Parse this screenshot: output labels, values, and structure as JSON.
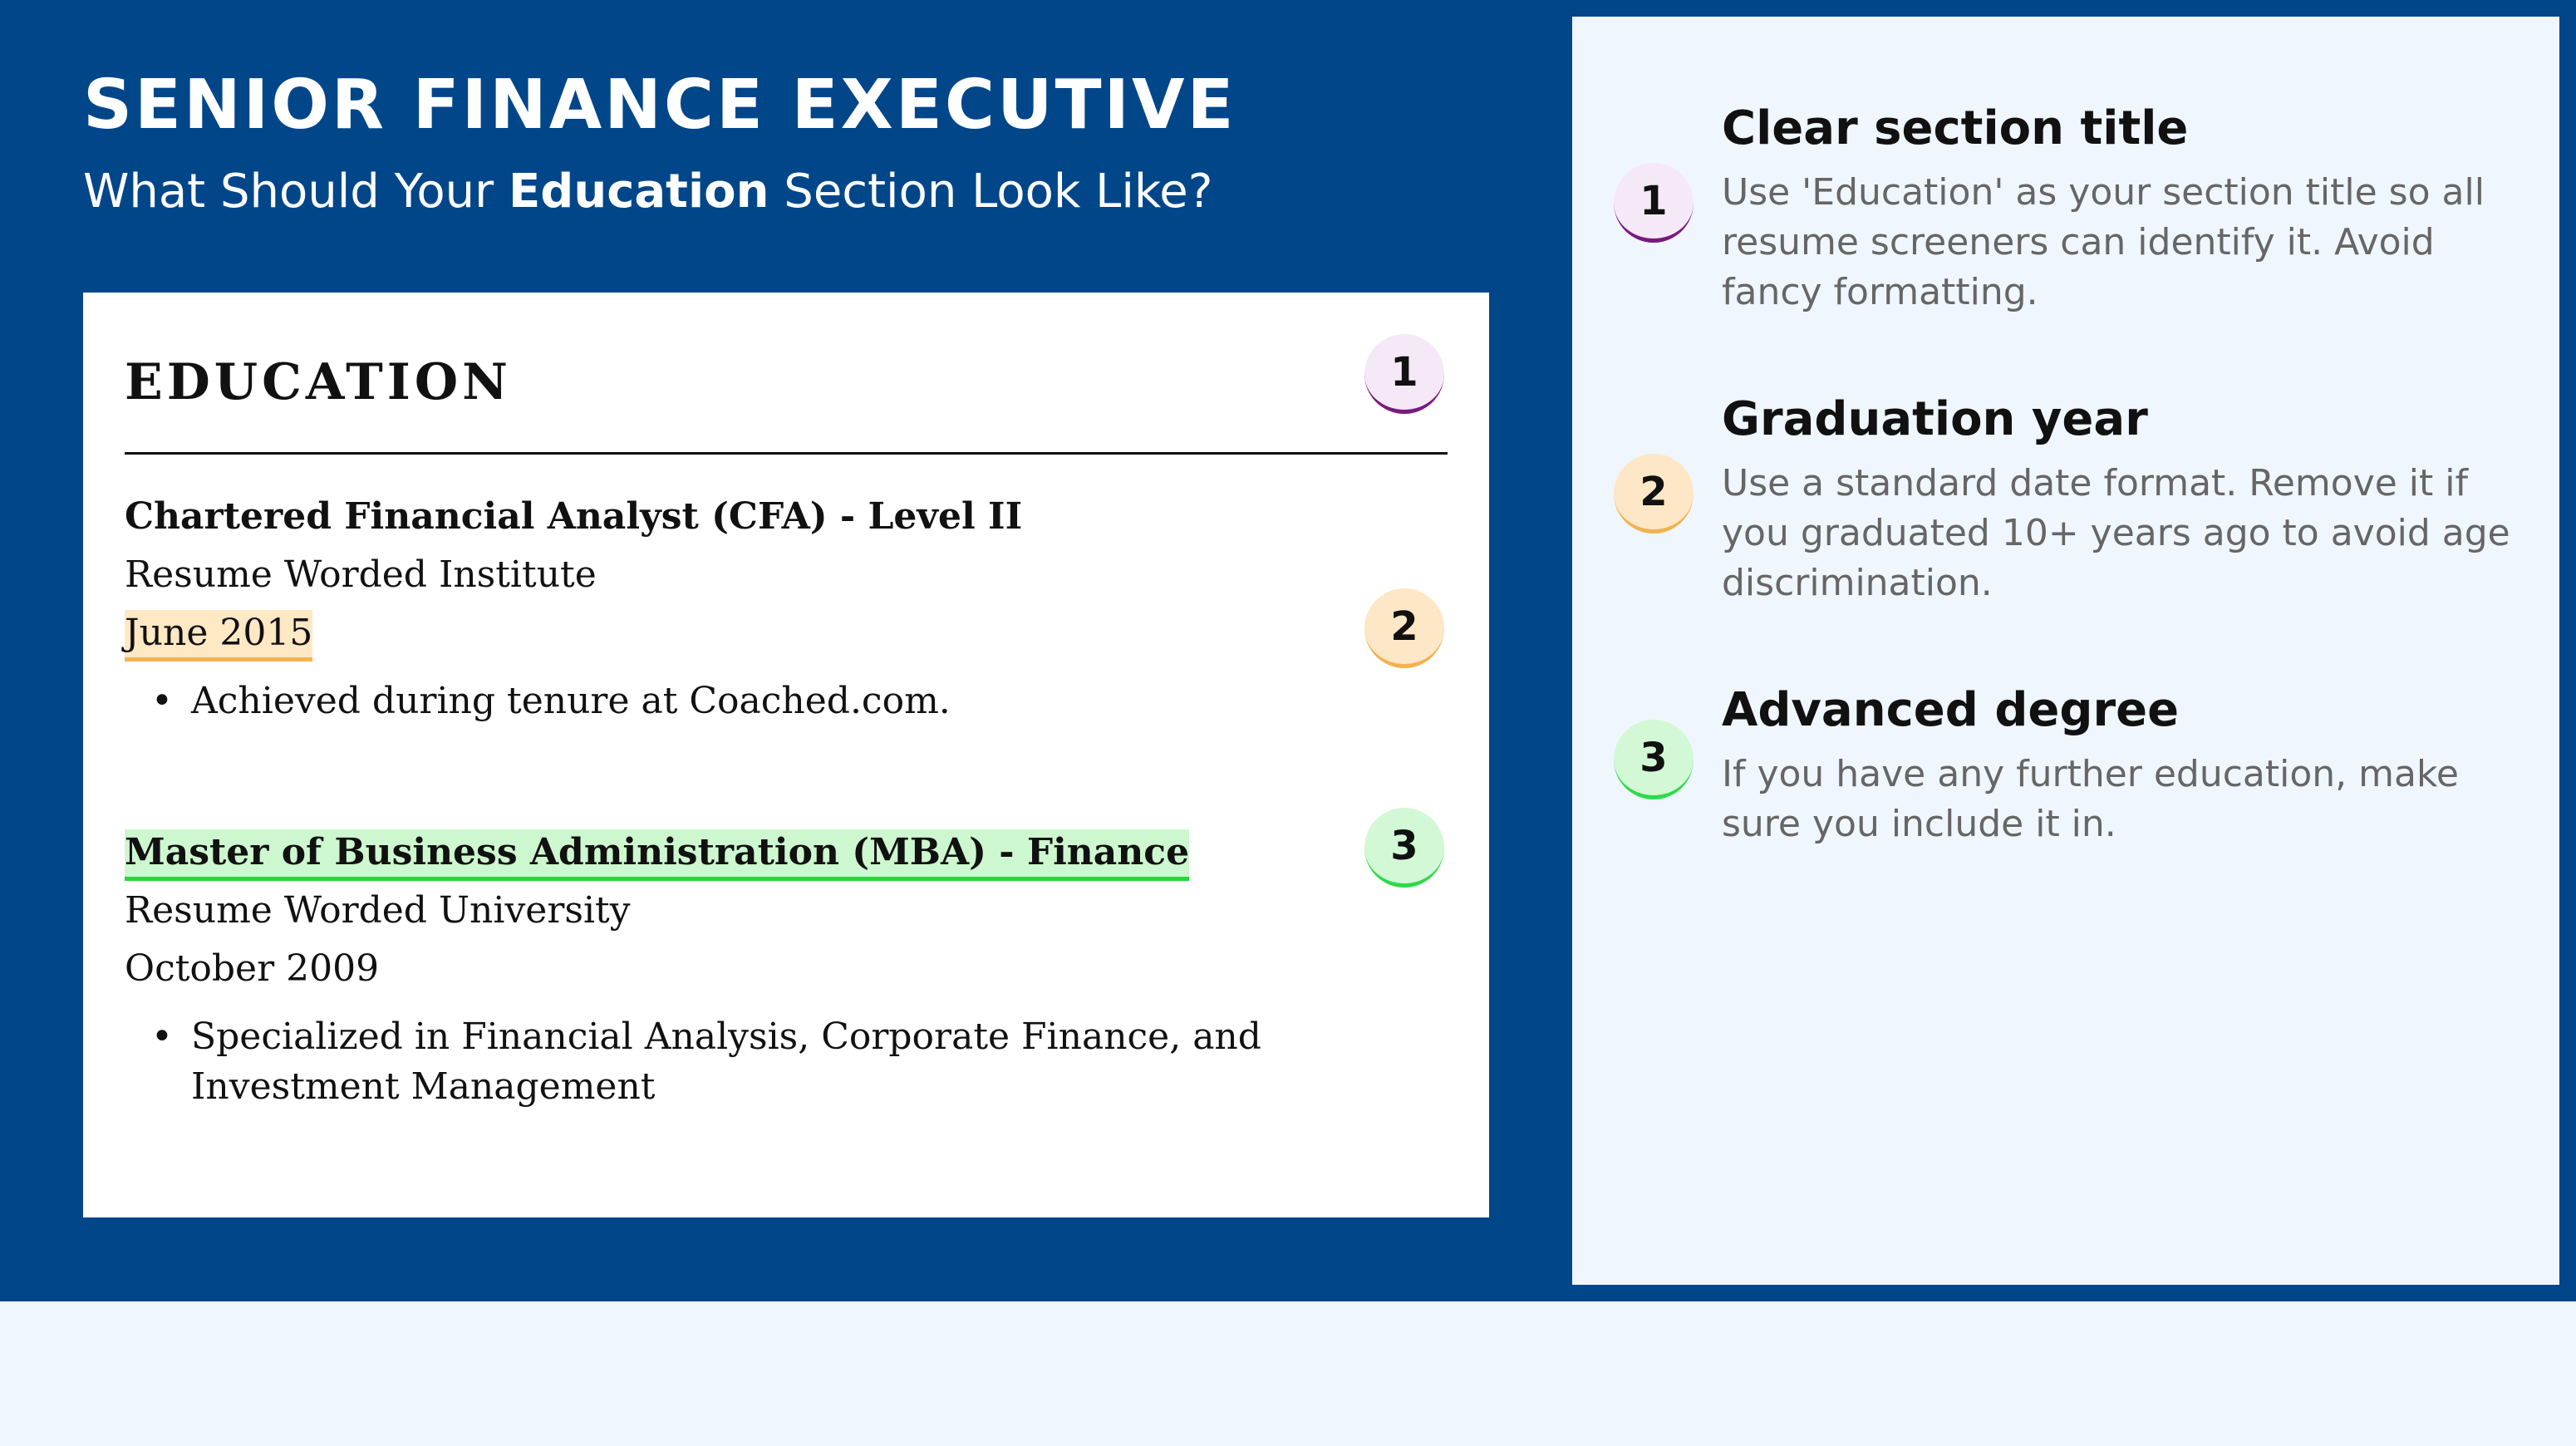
{
  "header": {
    "title": "SENIOR FINANCE EXECUTIVE",
    "subtitle_before": "What Should Your ",
    "subtitle_emphasis": "Education",
    "subtitle_after": " Section Look Like?"
  },
  "resume": {
    "section_title": "EDUCATION",
    "entries": [
      {
        "degree": "Chartered Financial Analyst (CFA) - Level II",
        "institution": "Resume Worded Institute",
        "date": "June 2015",
        "bullet": "Achieved during tenure at Coached.com."
      },
      {
        "degree": "Master of Business Administration (MBA) - Finance",
        "institution": "Resume Worded University",
        "date": "October 2009",
        "bullet": "Specialized in Financial Analysis, Corporate Finance, and Investment Management"
      }
    ],
    "bullet_symbol": "•"
  },
  "badges": [
    "1",
    "2",
    "3"
  ],
  "badge_colors": {
    "1": {
      "fill": "#f5e9f7",
      "accent": "#7a1a7e"
    },
    "2": {
      "fill": "#fde7c7",
      "accent": "#f3b150"
    },
    "3": {
      "fill": "#d3f8d5",
      "accent": "#2fd94b"
    }
  },
  "tips": [
    {
      "title": "Clear section title",
      "body": "Use 'Education' as your section title so all resume screeners can identify it. Avoid fancy formatting."
    },
    {
      "title": "Graduation year",
      "body": "Use a standard date format. Remove it if you graduated 10+ years ago to avoid age discrimination."
    },
    {
      "title": "Advanced degree",
      "body": "If you have any further education, make sure you include it in."
    }
  ],
  "colors": {
    "banner": "#02468a",
    "page_background": "#eff6fe",
    "card": "#ffffff",
    "tip_text": "#666666"
  }
}
